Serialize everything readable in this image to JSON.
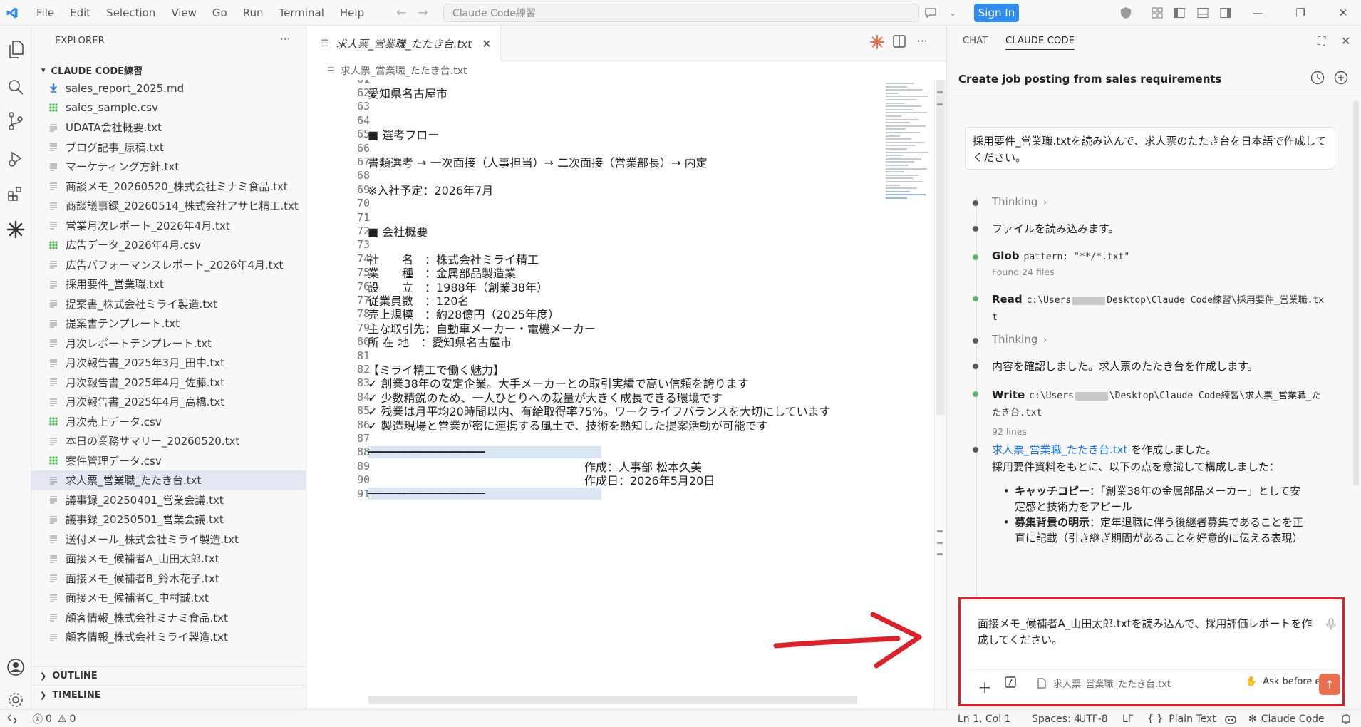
{
  "titlebar": {
    "menus": [
      "File",
      "Edit",
      "Selection",
      "View",
      "Go",
      "Run",
      "Terminal",
      "Help"
    ],
    "search_text": "Claude Code練習",
    "signin_label": "Sign In"
  },
  "explorer": {
    "title": "EXPLORER",
    "more": "···",
    "folder": "CLAUDE CODE練習",
    "files": [
      {
        "name": "sales_report_2025.md",
        "type": "md"
      },
      {
        "name": "sales_sample.csv",
        "type": "csv"
      },
      {
        "name": "UDATA会社概要.txt",
        "type": "txt"
      },
      {
        "name": "ブログ記事_原稿.txt",
        "type": "txt"
      },
      {
        "name": "マーケティング方針.txt",
        "type": "txt"
      },
      {
        "name": "商談メモ_20260520_株式会社ミナミ食品.txt",
        "type": "txt"
      },
      {
        "name": "商談議事録_20260514_株式会社アサヒ精工.txt",
        "type": "txt"
      },
      {
        "name": "営業月次レポート_2026年4月.txt",
        "type": "txt"
      },
      {
        "name": "広告データ_2026年4月.csv",
        "type": "csv"
      },
      {
        "name": "広告パフォーマンスレポート_2026年4月.txt",
        "type": "txt"
      },
      {
        "name": "採用要件_営業職.txt",
        "type": "txt"
      },
      {
        "name": "提案書_株式会社ミライ製造.txt",
        "type": "txt"
      },
      {
        "name": "提案書テンプレート.txt",
        "type": "txt"
      },
      {
        "name": "月次レポートテンプレート.txt",
        "type": "txt"
      },
      {
        "name": "月次報告書_2025年3月_田中.txt",
        "type": "txt"
      },
      {
        "name": "月次報告書_2025年4月_佐藤.txt",
        "type": "txt"
      },
      {
        "name": "月次報告書_2025年4月_高橋.txt",
        "type": "txt"
      },
      {
        "name": "月次売上データ.csv",
        "type": "csv"
      },
      {
        "name": "本日の業務サマリー_20260520.txt",
        "type": "txt"
      },
      {
        "name": "案件管理データ.csv",
        "type": "csv"
      },
      {
        "name": "求人票_営業職_たたき台.txt",
        "type": "txt",
        "selected": true
      },
      {
        "name": "議事録_20250401_営業会議.txt",
        "type": "txt"
      },
      {
        "name": "議事録_20250501_営業会議.txt",
        "type": "txt"
      },
      {
        "name": "送付メール_株式会社ミライ製造.txt",
        "type": "txt"
      },
      {
        "name": "面接メモ_候補者A_山田太郎.txt",
        "type": "txt"
      },
      {
        "name": "面接メモ_候補者B_鈴木花子.txt",
        "type": "txt"
      },
      {
        "name": "面接メモ_候補者C_中村誠.txt",
        "type": "txt"
      },
      {
        "name": "顧客情報_株式会社ミナミ食品.txt",
        "type": "txt"
      },
      {
        "name": "顧客情報_株式会社ミライ製造.txt",
        "type": "txt"
      }
    ],
    "outline": "OUTLINE",
    "timeline": "TIMELINE"
  },
  "editor": {
    "tab_label": "求人票_営業職_たたき台.txt",
    "breadcrumb": "求人票_営業職_たたき台.txt",
    "lines": [
      {
        "n": "61",
        "t": ""
      },
      {
        "n": "62",
        "t": "愛知県名古屋市"
      },
      {
        "n": "63",
        "t": ""
      },
      {
        "n": "64",
        "t": ""
      },
      {
        "n": "65",
        "t": "■ 選考フロー"
      },
      {
        "n": "66",
        "t": ""
      },
      {
        "n": "67",
        "t": "書類選考 → 一次面接（人事担当）→ 二次面接（営業部長）→ 内定"
      },
      {
        "n": "68",
        "t": ""
      },
      {
        "n": "69",
        "t": "※入社予定：2026年7月"
      },
      {
        "n": "70",
        "t": ""
      },
      {
        "n": "71",
        "t": ""
      },
      {
        "n": "72",
        "t": "■ 会社概要"
      },
      {
        "n": "73",
        "t": ""
      },
      {
        "n": "74",
        "t": "社　　名　：株式会社ミライ精工"
      },
      {
        "n": "75",
        "t": "業　　種　：金属部品製造業"
      },
      {
        "n": "76",
        "t": "設　　立　：1988年（創業38年）"
      },
      {
        "n": "77",
        "t": "従業員数　：120名"
      },
      {
        "n": "78",
        "t": "売上規模　：約28億円（2025年度）"
      },
      {
        "n": "79",
        "t": "主な取引先：自動車メーカー・電機メーカー"
      },
      {
        "n": "80",
        "t": "所 在 地　：愛知県名古屋市"
      },
      {
        "n": "81",
        "t": ""
      },
      {
        "n": "82",
        "t": "【ミライ精工で働く魅力】"
      },
      {
        "n": "83",
        "t": "✓ 創業38年の安定企業。大手メーカーとの取引実績で高い信頼を誇ります"
      },
      {
        "n": "84",
        "t": "✓ 少数精鋭のため、一人ひとりへの裁量が大きく成長できる環境です"
      },
      {
        "n": "85",
        "t": "✓ 残業は月平均20時間以内、有給取得率75%。ワークライフバランスを大切にしています"
      },
      {
        "n": "86",
        "t": "✓ 製造現場と営業が密に連携する風土で、技術を熟知した提案活動が可能です"
      },
      {
        "n": "87",
        "t": ""
      },
      {
        "n": "88",
        "t": "━━━━━━━━━━━━━━━━━━━━━━━━━━━━━"
      },
      {
        "n": "89",
        "t": "　　　　　　　　　　　　　　　　　　　作成：人事部 松本久美"
      },
      {
        "n": "90",
        "t": "　　　　　　　　　　　　　　　　　　　作成日：2026年5月20日"
      },
      {
        "n": "91",
        "t": "━━━━━━━━━━━━━━━━━━━━━━━━━━━━━"
      }
    ]
  },
  "panel": {
    "tab_chat": "CHAT",
    "tab_claude": "CLAUDE CODE",
    "conversation_title": "Create job posting from sales requirements",
    "user_message": "採用要件_営業職.txtを読み込んで、求人票のたたき台を日本語で作成してください。",
    "steps": {
      "thinking1": "Thinking",
      "read_files": "ファイルを読み込みます。",
      "glob_label": "Glob",
      "glob_arg": "pattern: \"**/*.txt\"",
      "glob_result": "Found 24 files",
      "read_label": "Read",
      "read_arg_a": "c:\\Users",
      "read_arg_b": "Desktop\\Claude Code練習\\採用要件_営業職.tx",
      "read_arg_c": "t",
      "thinking2": "Thinking",
      "confirm": "内容を確認しました。求人票のたたき台を作成します。",
      "write_label": "Write",
      "write_arg_a": "c:\\Users",
      "write_arg_b": "\\Desktop\\Claude Code練習\\求人票_営業職_た",
      "write_arg_c": "たき台.txt",
      "write_result": "92 lines",
      "created_link": "求人票_営業職_たたき台.txt",
      "created_text": " を作成しました。",
      "summary": "採用要件資料をもとに、以下の点を意識して構成しました：",
      "bullet1_key": "キャッチコピー",
      "bullet1_text": "：「創業38年の金属部品メーカー」として安",
      "bullet1_cont": "定感と技術力をアピール",
      "bullet2_key": "募集背景の明示",
      "bullet2_text": "：定年退職に伴う後継者募集であることを正",
      "bullet2_cont": "直に記載（引き継ぎ期間があることを好意的に伝える表現）"
    },
    "composer": {
      "text": "面接メモ_候補者A_山田太郎.txtを読み込んで、採用評価レポートを作成してください。",
      "file_chip": "求人票_営業職_たたき台.txt",
      "mode": "Ask before edits"
    }
  },
  "statusbar": {
    "errors": "0",
    "warnings": "0",
    "position": "Ln 1, Col 1",
    "spaces": "Spaces: 4",
    "encoding": "UTF-8",
    "eol": "LF",
    "language": "Plain Text",
    "claude": "Claude Code"
  },
  "colors": {
    "accent_blue": "#2f8df0",
    "highlight_red": "#d8232a",
    "claude_orange": "#e86f4e",
    "csv_green": "#4caf50"
  }
}
